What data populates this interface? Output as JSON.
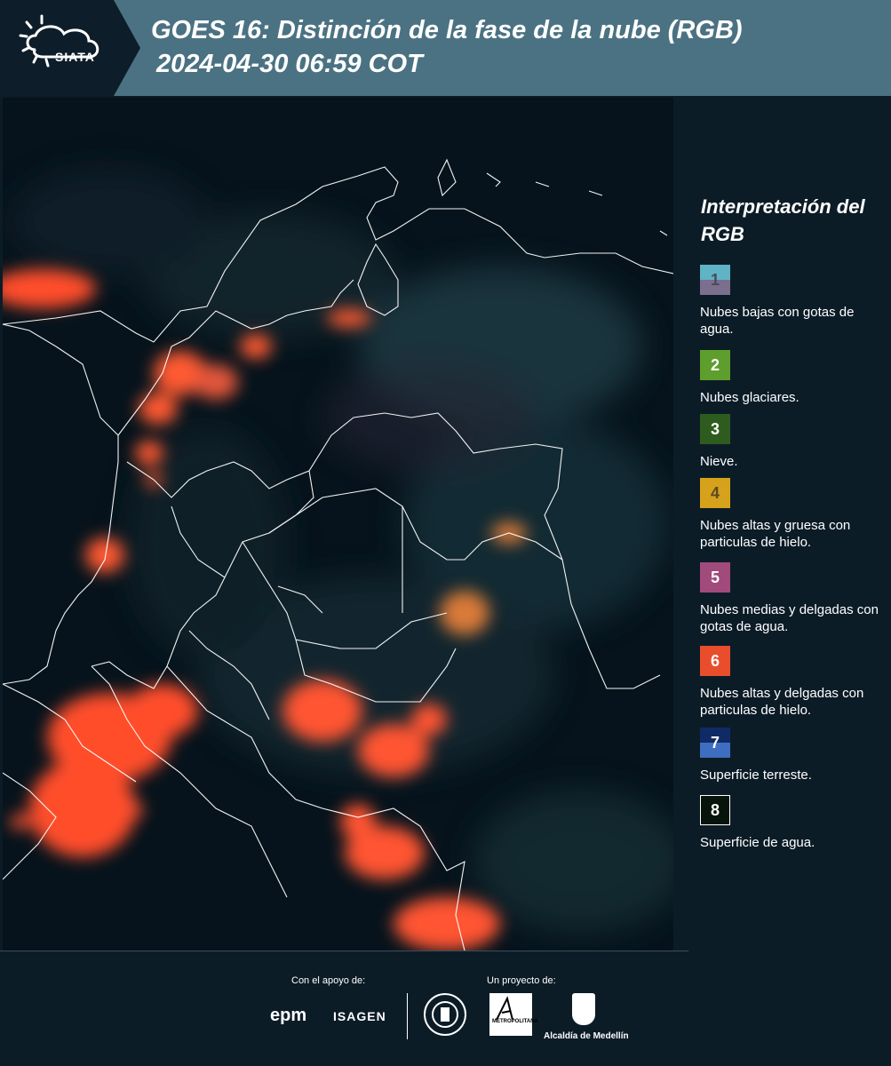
{
  "header": {
    "logo_text": "SIATA",
    "title": "GOES 16: Distinción de la fase de la nube (RGB)",
    "timestamp": "2024-04-30 06:59 COT"
  },
  "legend": {
    "title": "Interpretación del RGB",
    "items": [
      {
        "number": "1",
        "label": "Nubes bajas con gotas de agua.",
        "color_top": "#5fb3c4",
        "color_bottom": "#7a6f8c"
      },
      {
        "number": "2",
        "label": "Nubes glaciares.",
        "color_top": "#5e9e2c",
        "color_bottom": "#5e9e2c"
      },
      {
        "number": "3",
        "label": "Nieve.",
        "color_top": "#2e5c1e",
        "color_bottom": "#2e5c1e"
      },
      {
        "number": "4",
        "label": "Nubes altas y gruesa con particulas de hielo.",
        "color_top": "#d6a21c",
        "color_bottom": "#d6a21c"
      },
      {
        "number": "5",
        "label": "Nubes medias y delgadas con gotas de agua.",
        "color_top": "#a14a7c",
        "color_bottom": "#a14a7c"
      },
      {
        "number": "6",
        "label": "Nubes altas y delgadas con particulas de hielo.",
        "color_top": "#e84d2c",
        "color_bottom": "#e84d2c"
      },
      {
        "number": "7",
        "label": "Superficie terreste.",
        "color_top": "#102a66",
        "color_bottom": "#3f6ec0"
      },
      {
        "number": "8",
        "label": "Superficie de agua.",
        "color_top": "#07140b",
        "color_bottom": "#07140b"
      }
    ]
  },
  "footer": {
    "support_label": "Con el apoyo de:",
    "project_label": "Un proyecto de:",
    "sponsor_1": "epm",
    "sponsor_2": "ISAGEN",
    "area_logo_text": "METROPOLITANA",
    "alcaldia": "Alcaldía de Medellín"
  }
}
